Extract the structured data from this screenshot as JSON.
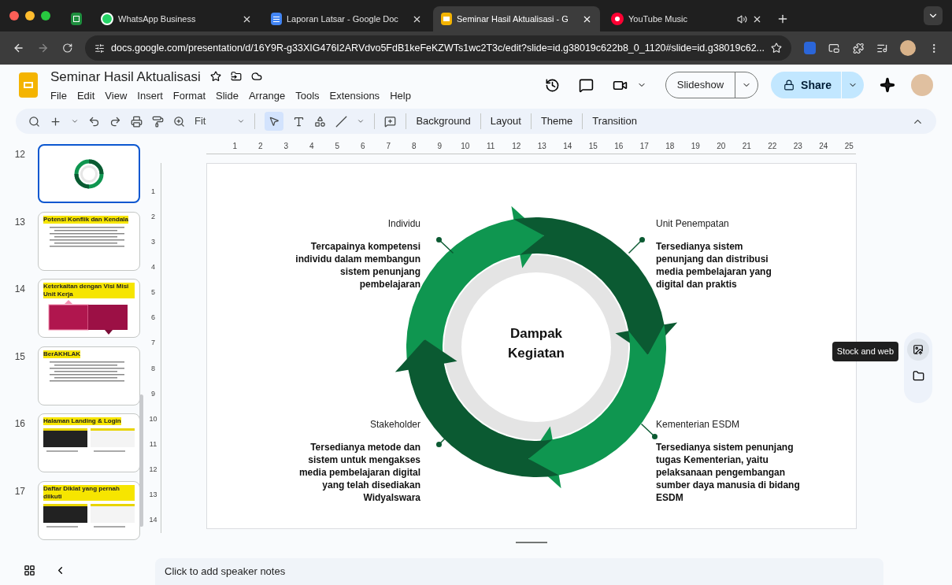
{
  "browser": {
    "tabs": [
      {
        "kind": "sheets",
        "selected": false,
        "audio": false
      },
      {
        "kind": "whatsapp",
        "title": "WhatsApp Business",
        "selected": false,
        "audio": false
      },
      {
        "kind": "docs",
        "title": "Laporan Latsar - Google Doc",
        "selected": false,
        "audio": false
      },
      {
        "kind": "slides",
        "title": "Seminar Hasil Aktualisasi - G",
        "selected": true,
        "audio": false
      },
      {
        "kind": "youtube-music",
        "title": "YouTube Music",
        "selected": false,
        "audio": true
      }
    ],
    "url": "docs.google.com/presentation/d/16Y9R-g33XIG476I2ARVdvo5FdB1keFeKZWTs1wc2T3c/edit?slide=id.g38019c622b8_0_1120#slide=id.g38019c62..."
  },
  "app": {
    "title": "Seminar Hasil Aktualisasi",
    "menus": [
      "File",
      "Edit",
      "View",
      "Insert",
      "Format",
      "Slide",
      "Arrange",
      "Tools",
      "Extensions",
      "Help"
    ],
    "slideshow_label": "Slideshow",
    "share_label": "Share",
    "zoom_label": "Fit",
    "toolbar_buttons": [
      "Background",
      "Layout",
      "Theme",
      "Transition"
    ]
  },
  "filmstrip": [
    {
      "number": "12",
      "kind": "ring",
      "selected": true
    },
    {
      "number": "13",
      "kind": "text",
      "title": "Potensi Konflik dan Kendala",
      "selected": false
    },
    {
      "number": "14",
      "kind": "panels",
      "title": "Keterkaitan dengan Visi Misi Unit Kerja",
      "selected": false
    },
    {
      "number": "15",
      "kind": "text",
      "title": "BerAKHLAK",
      "selected": false
    },
    {
      "number": "16",
      "kind": "screens",
      "title": "Halaman Landing & Login",
      "selected": false
    },
    {
      "number": "17",
      "kind": "screens",
      "title": "Daftar Diklat yang pernah diikuti",
      "selected": false
    }
  ],
  "ruler": {
    "horizontal": [
      "1",
      "2",
      "3",
      "4",
      "5",
      "6",
      "7",
      "8",
      "9",
      "10",
      "11",
      "12",
      "13",
      "14",
      "15",
      "16",
      "17",
      "18",
      "19",
      "20",
      "21",
      "22",
      "23",
      "24",
      "25"
    ],
    "vertical": [
      "1",
      "2",
      "3",
      "4",
      "5",
      "6",
      "7",
      "8",
      "9",
      "10",
      "11",
      "12",
      "13",
      "14"
    ]
  },
  "slide": {
    "center_title": "Dampak Kegiatan",
    "quadrants": [
      {
        "heading": "Individu",
        "body": "Tercapainya kompetensi individu dalam membangun sistem penunjang pembelajaran"
      },
      {
        "heading": "Unit Penempatan",
        "body": "Tersedianya sistem penunjang dan distribusi media pembelajaran yang digital dan praktis"
      },
      {
        "heading": "Stakeholder",
        "body": "Tersedianya metode dan sistem untuk mengakses media pembelajaran digital yang telah disediakan Widyalswara"
      },
      {
        "heading": "Kementerian ESDM",
        "body": "Tersedianya sistem penunjang tugas Kementerian, yaitu pelaksanaan pengembangan sumber daya manusia di bidang ESDM"
      }
    ]
  },
  "side_panel": {
    "tooltip": "Stock and web"
  },
  "speaker_notes": {
    "placeholder": "Click to add speaker notes"
  }
}
